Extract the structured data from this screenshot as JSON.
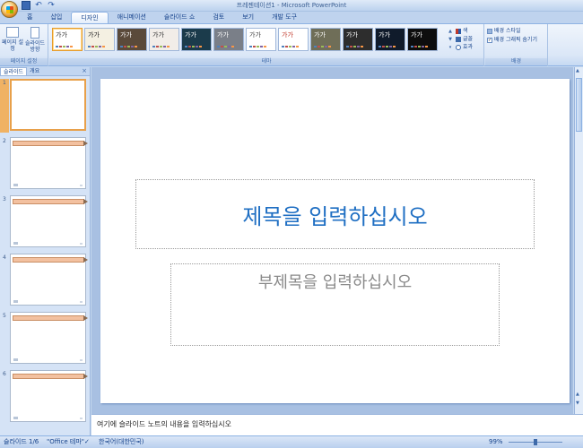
{
  "window": {
    "title": "프레젠테이션1 - Microsoft PowerPoint"
  },
  "tabs": [
    {
      "label": "홈"
    },
    {
      "label": "삽입"
    },
    {
      "label": "디자인"
    },
    {
      "label": "애니메이션"
    },
    {
      "label": "슬라이드 쇼"
    },
    {
      "label": "검토"
    },
    {
      "label": "보기"
    },
    {
      "label": "개발 도구"
    }
  ],
  "ribbon": {
    "page_setup": {
      "page_setup_label": "페이지 설정",
      "orientation_label": "슬라이드 방향",
      "group_label": "페이지 설정"
    },
    "themes": {
      "group_label": "테마",
      "items": [
        {
          "text": "가가",
          "bg": "#ffffff",
          "fg": "#333333"
        },
        {
          "text": "가가",
          "bg": "#f4f0e2",
          "fg": "#222222"
        },
        {
          "text": "가가",
          "bg": "#5a4a3a",
          "fg": "#ffffff"
        },
        {
          "text": "가가",
          "bg": "#f2ede8",
          "fg": "#333333"
        },
        {
          "text": "가가",
          "bg": "#1b3b4b",
          "fg": "#ffffff"
        },
        {
          "text": "가가",
          "bg": "#7a7f88",
          "fg": "#ffffff"
        },
        {
          "text": "가가",
          "bg": "#ffffff",
          "fg": "#444444"
        },
        {
          "text": "가가",
          "bg": "#ffffff",
          "fg": "#c0392b"
        },
        {
          "text": "가가",
          "bg": "#6f6e58",
          "fg": "#ffffff"
        },
        {
          "text": "가가",
          "bg": "#2d2d2d",
          "fg": "#ffffff"
        },
        {
          "text": "가가",
          "bg": "#101b2b",
          "fg": "#ffffff"
        },
        {
          "text": "가가",
          "bg": "#0d0d0d",
          "fg": "#ffffff"
        }
      ],
      "colors_label": "색",
      "fonts_label": "글꼴",
      "effects_label": "효과"
    },
    "background": {
      "group_label": "배경",
      "styles_label": "배경 스타일",
      "hide_graphics_label": "배경 그래픽 숨기기"
    }
  },
  "left_pane": {
    "tab_slides": "슬라이드",
    "tab_outline": "개요",
    "close_glyph": "×",
    "slides": [
      {
        "num": "1"
      },
      {
        "num": "2"
      },
      {
        "num": "3"
      },
      {
        "num": "4"
      },
      {
        "num": "5"
      },
      {
        "num": "6"
      }
    ]
  },
  "slide": {
    "title_placeholder": "제목을 입력하십시오",
    "subtitle_placeholder": "부제목을 입력하십시오"
  },
  "notes": {
    "placeholder": "여기에 슬라이드 노트의 내용을 입력하십시오"
  },
  "status": {
    "slide_info": "슬라이드 1/6",
    "theme": "\"Office 테마\"",
    "language": "한국어(대한민국)",
    "zoom": "99%"
  }
}
